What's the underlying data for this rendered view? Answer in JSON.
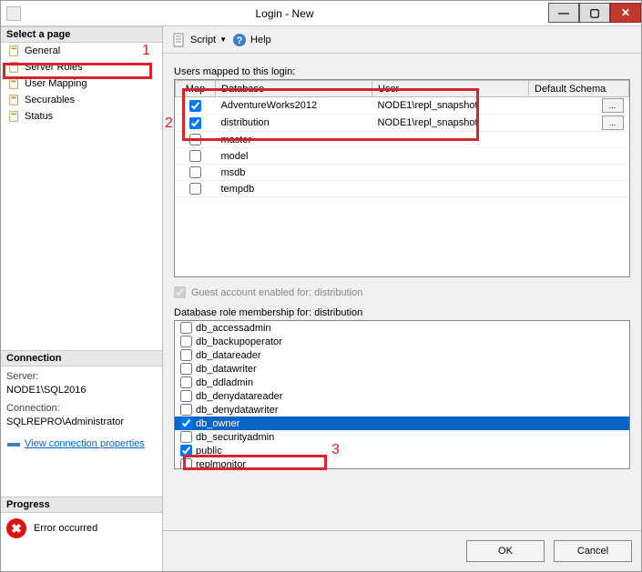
{
  "window": {
    "title": "Login - New"
  },
  "sidebar": {
    "select_page_hdr": "Select a page",
    "pages": [
      {
        "label": "General"
      },
      {
        "label": "Server Roles"
      },
      {
        "label": "User Mapping"
      },
      {
        "label": "Securables"
      },
      {
        "label": "Status"
      }
    ],
    "connection_hdr": "Connection",
    "server_label": "Server:",
    "server_value": "NODE1\\SQL2016",
    "connection_label": "Connection:",
    "connection_value": "SQLREPRO\\Administrator",
    "view_props": "View connection properties",
    "progress_hdr": "Progress",
    "progress_text": "Error occurred"
  },
  "toolbar": {
    "script": "Script",
    "help": "Help"
  },
  "main": {
    "users_mapped_label": "Users mapped to this login:",
    "columns": {
      "map": "Map",
      "database": "Database",
      "user": "User",
      "schema": "Default Schema"
    },
    "rows": [
      {
        "map": true,
        "database": "AdventureWorks2012",
        "user": "NODE1\\repl_snapshot",
        "schema": "",
        "ellipsis": true
      },
      {
        "map": true,
        "database": "distribution",
        "user": "NODE1\\repl_snapshot",
        "schema": "",
        "ellipsis": true
      },
      {
        "map": false,
        "database": "master",
        "user": "",
        "schema": "",
        "ellipsis": false
      },
      {
        "map": false,
        "database": "model",
        "user": "",
        "schema": "",
        "ellipsis": false
      },
      {
        "map": false,
        "database": "msdb",
        "user": "",
        "schema": "",
        "ellipsis": false
      },
      {
        "map": false,
        "database": "tempdb",
        "user": "",
        "schema": "",
        "ellipsis": false
      }
    ],
    "guest_label": "Guest account enabled for: distribution",
    "roles_label": "Database role membership for: distribution",
    "roles": [
      {
        "name": "db_accessadmin",
        "checked": false,
        "selected": false
      },
      {
        "name": "db_backupoperator",
        "checked": false,
        "selected": false
      },
      {
        "name": "db_datareader",
        "checked": false,
        "selected": false
      },
      {
        "name": "db_datawriter",
        "checked": false,
        "selected": false
      },
      {
        "name": "db_ddladmin",
        "checked": false,
        "selected": false
      },
      {
        "name": "db_denydatareader",
        "checked": false,
        "selected": false
      },
      {
        "name": "db_denydatawriter",
        "checked": false,
        "selected": false
      },
      {
        "name": "db_owner",
        "checked": true,
        "selected": true
      },
      {
        "name": "db_securityadmin",
        "checked": false,
        "selected": false
      },
      {
        "name": "public",
        "checked": true,
        "selected": false
      },
      {
        "name": "replmonitor",
        "checked": false,
        "selected": false
      }
    ]
  },
  "footer": {
    "ok": "OK",
    "cancel": "Cancel"
  },
  "annotations": {
    "n1": "1",
    "n2": "2",
    "n3": "3"
  }
}
